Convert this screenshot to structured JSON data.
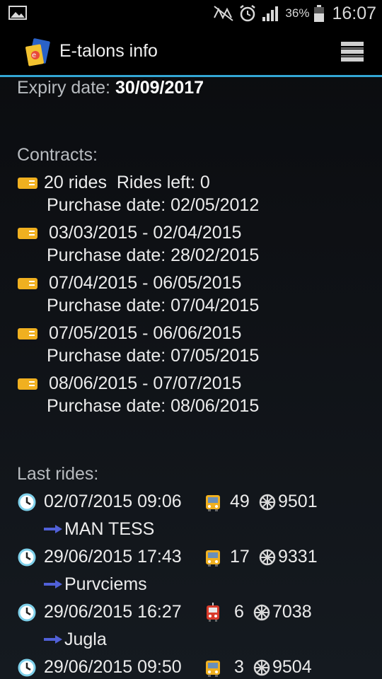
{
  "status_bar": {
    "battery_percent": "36%",
    "time": "16:07",
    "icons": [
      "image-icon",
      "mute-icon",
      "alarm-icon",
      "signal-icon",
      "battery-icon"
    ]
  },
  "app_bar": {
    "title": "E-talons info",
    "icons": [
      "app-logo-icon",
      "menu-icon"
    ]
  },
  "expiry": {
    "label": "Expiry date:",
    "value": "30/09/2017"
  },
  "contracts": {
    "heading": "Contracts:",
    "items": [
      {
        "line1": "20 rides  Rides left: 0",
        "line2": "Purchase date: 02/05/2012"
      },
      {
        "line1": "03/03/2015 - 02/04/2015",
        "line2": "Purchase date: 28/02/2015"
      },
      {
        "line1": "07/04/2015 - 06/05/2015",
        "line2": "Purchase date: 07/04/2015"
      },
      {
        "line1": "07/05/2015 - 06/06/2015",
        "line2": "Purchase date: 07/05/2015"
      },
      {
        "line1": "08/06/2015 - 07/07/2015",
        "line2": "Purchase date: 08/06/2015"
      }
    ]
  },
  "last_rides": {
    "heading": "Last rides:",
    "items": [
      {
        "datetime": "02/07/2015 09:06",
        "vehicle": "trolleybus",
        "route": "49",
        "vehicle_no": "9501",
        "stop": "MAN TESS"
      },
      {
        "datetime": "29/06/2015 17:43",
        "vehicle": "trolleybus",
        "route": "17",
        "vehicle_no": "9331",
        "stop": "Purvciems"
      },
      {
        "datetime": "29/06/2015 16:27",
        "vehicle": "tram",
        "route": "6",
        "vehicle_no": "7038",
        "stop": "Jugla"
      },
      {
        "datetime": "29/06/2015 09:50",
        "vehicle": "trolleybus",
        "route": "3",
        "vehicle_no": "9504",
        "stop": ""
      }
    ]
  },
  "colors": {
    "accent": "#33a6d4",
    "ticket": "#f0b020",
    "clock": "#7ed0ea",
    "arrow": "#5060d8"
  }
}
